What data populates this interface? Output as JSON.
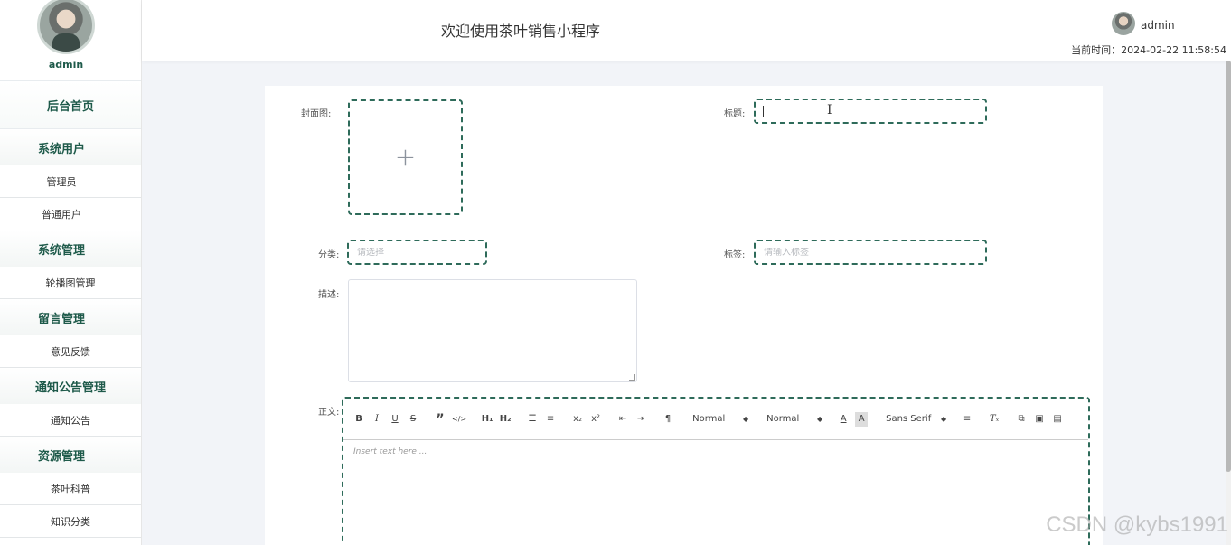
{
  "sidebar": {
    "profile_name": "admin",
    "home": "后台首页",
    "groups": [
      {
        "title": "系统用户",
        "items": [
          "管理员",
          "普通用户"
        ]
      },
      {
        "title": "系统管理",
        "items": [
          "轮播图管理"
        ]
      },
      {
        "title": "留言管理",
        "items": [
          "意见反馈"
        ]
      },
      {
        "title": "通知公告管理",
        "items": [
          "通知公告"
        ]
      },
      {
        "title": "资源管理",
        "items": [
          "茶叶科普",
          "知识分类"
        ]
      }
    ]
  },
  "header": {
    "title": "欢迎使用茶叶销售小程序",
    "user": "admin",
    "time_label": "当前时间：",
    "time_value": "2024-02-22 11:58:54"
  },
  "form": {
    "cover_label": "封面图:",
    "title_label": "标题:",
    "title_value": "",
    "category_label": "分类:",
    "category_placeholder": "请选择",
    "tags_label": "标签:",
    "tags_placeholder": "请输入标签",
    "desc_label": "描述:",
    "body_label": "正文:"
  },
  "editor": {
    "toolbar": {
      "bold": "B",
      "italic": "I",
      "underline": "U",
      "strike": "S",
      "quote": "”",
      "code": "</>",
      "h1": "H₁",
      "h2": "H₂",
      "ordered_list": "☰",
      "bullet_list": "≡",
      "sub": "x₂",
      "sup": "x²",
      "outdent": "⇤",
      "indent": "⇥",
      "direction": "¶",
      "size_value": "Normal",
      "header_value": "Normal",
      "color": "A",
      "background": "A",
      "font_value": "Sans Serif",
      "align": "≡",
      "clean": "Tₓ",
      "link": "⧉",
      "image": "▣",
      "video": "▤"
    },
    "placeholder": "Insert text here ..."
  },
  "watermark": "CSDN @kybs1991",
  "colors": {
    "accent": "#1e5a4a",
    "dashed_border": "#2e6b5a"
  }
}
